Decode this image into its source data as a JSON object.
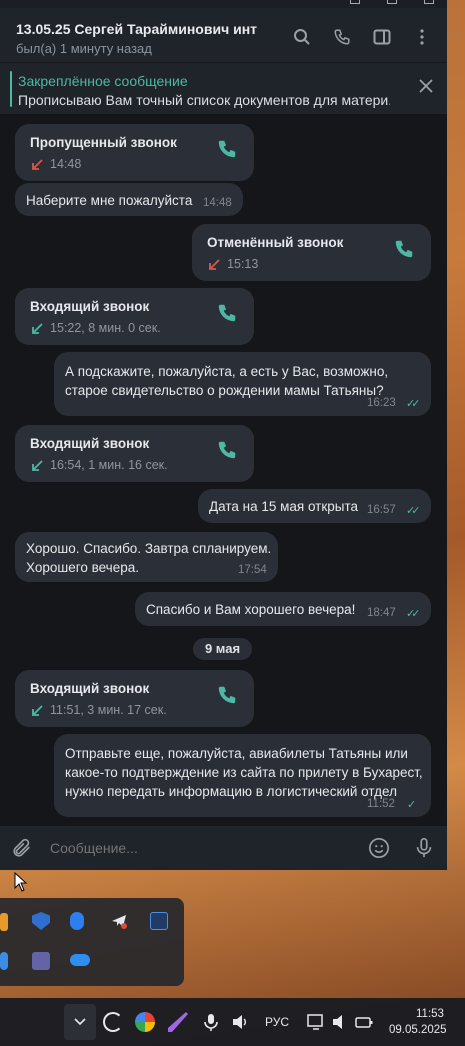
{
  "header": {
    "contact_name": "13.05.25 Сергей Тарайминович инт",
    "status": "был(а) 1 минуту назад"
  },
  "pinned": {
    "title": "Закреплённое сообщение",
    "text": "Прописываю Вам точный список документов для матери..."
  },
  "messages": [
    {
      "type": "call",
      "dir": "in",
      "title": "Пропущенный звонок",
      "meta": "14:48",
      "arrow": "missed"
    },
    {
      "type": "text",
      "dir": "in",
      "text": "Наберите мне пожалуйста",
      "time": "14:48"
    },
    {
      "type": "call",
      "dir": "out",
      "title": "Отменённый звонок",
      "meta": "15:13",
      "arrow": "missed"
    },
    {
      "type": "call",
      "dir": "in",
      "title": "Входящий звонок",
      "meta": "15:22, 8 мин. 0 сек.",
      "arrow": "incoming"
    },
    {
      "type": "text",
      "dir": "out",
      "lines": [
        "А подскажите, пожалуйста, а есть у Вас, возможно,",
        "старое свидетельство о рождении мамы Татьяны?"
      ],
      "time": "16:23",
      "ticks": "✓✓"
    },
    {
      "type": "call",
      "dir": "in",
      "title": "Входящий звонок",
      "meta": "16:54, 1 мин. 16 сек.",
      "arrow": "incoming"
    },
    {
      "type": "text",
      "dir": "out",
      "text": "Дата на 15 мая открыта",
      "time": "16:57",
      "ticks": "✓✓"
    },
    {
      "type": "text",
      "dir": "in",
      "lines": [
        "Хорошо. Спасибо. Завтра спланируем.",
        "Хорошего вечера."
      ],
      "time": "17:54"
    },
    {
      "type": "text",
      "dir": "out",
      "text": "Спасибо и Вам хорошего вечера!",
      "time": "18:47",
      "ticks": "✓✓"
    },
    {
      "type": "call",
      "dir": "in",
      "title": "Входящий звонок",
      "meta": "11:51, 3 мин. 17 сек.",
      "arrow": "incoming"
    },
    {
      "type": "text",
      "dir": "out",
      "lines": [
        "Отправьте еще, пожалуйста, авиабилеты Татьяны или",
        "какое-то подтверждение из сайта по прилету в Бухарест,",
        "нужно передать информацию в логистический отдел"
      ],
      "time": "11:52",
      "ticks": "✓"
    }
  ],
  "date_divider": "9 мая",
  "compose": {
    "placeholder": "Сообщение..."
  },
  "taskbar": {
    "language": "РУС",
    "time": "11:53",
    "date": "09.05.2025"
  },
  "colors": {
    "accent": "#4db8a3",
    "missed": "#d9584a",
    "bubble": "#2b3038",
    "chat_bg": "#14161a"
  }
}
